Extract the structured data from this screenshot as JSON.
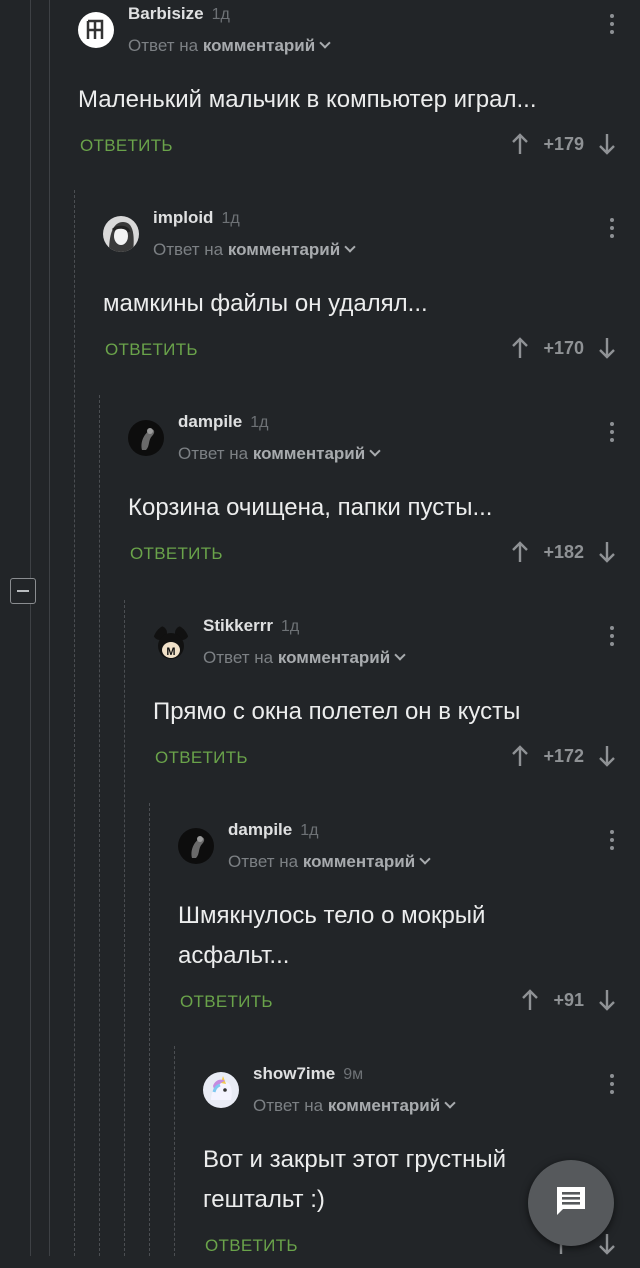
{
  "comments": [
    {
      "username": "Barbisize",
      "time": "1д",
      "reply_prefix": "Ответ на",
      "reply_target": "комментарий",
      "text": "Маленький мальчик в компьютер играл...",
      "reply_label": "ОТВЕТИТЬ",
      "rating": "+179",
      "avatar": "rammstein-logo"
    },
    {
      "username": "imploid",
      "time": "1д",
      "reply_prefix": "Ответ на",
      "reply_target": "комментарий",
      "text": "мамкины файлы он удалял...",
      "reply_label": "ОТВЕТИТЬ",
      "rating": "+170",
      "avatar": "anime-girl"
    },
    {
      "username": "dampile",
      "time": "1д",
      "reply_prefix": "Ответ на",
      "reply_target": "комментарий",
      "text": "Корзина очищена, папки пусты...",
      "reply_label": "ОТВЕТИТЬ",
      "rating": "+182",
      "avatar": "dark-figure"
    },
    {
      "username": "Stikkerrr",
      "time": "1д",
      "reply_prefix": "Ответ на",
      "reply_target": "комментарий",
      "text": "Прямо с окна полетел он в кусты",
      "reply_label": "ОТВЕТИТЬ",
      "rating": "+172",
      "avatar": "mickey"
    },
    {
      "username": "dampile",
      "time": "1д",
      "reply_prefix": "Ответ на",
      "reply_target": "комментарий",
      "text": "Шмякнулось тело о мокрый асфальт...",
      "reply_label": "ОТВЕТИТЬ",
      "rating": "+91",
      "avatar": "dark-figure"
    },
    {
      "username": "show7ime",
      "time": "9м",
      "reply_prefix": "Ответ на",
      "reply_target": "комментарий",
      "text": "Вот и закрыт этот грустный гештальт :)",
      "reply_label": "ОТВЕТИТЬ",
      "rating": "",
      "avatar": "unicorn"
    }
  ],
  "colors": {
    "background": "#222528",
    "reply_green": "#6aa34a",
    "text": "#eceded",
    "muted": "#7c8084"
  },
  "icons": {
    "upvote": "arrow-up-icon",
    "downvote": "arrow-down-icon",
    "menu": "kebab-menu-icon",
    "collapse": "minus-box-icon",
    "fab": "comment-icon"
  }
}
